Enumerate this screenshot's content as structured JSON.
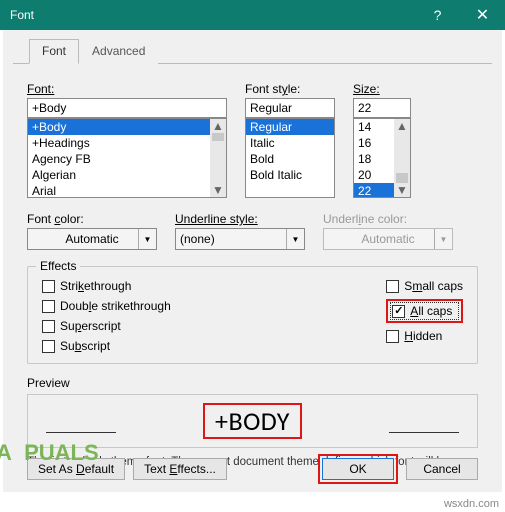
{
  "title": "Font",
  "tabs": {
    "font": "Font",
    "advanced": "Advanced"
  },
  "font": {
    "label": "Font:",
    "value": "+Body",
    "items": [
      "+Body",
      "+Headings",
      "Agency FB",
      "Algerian",
      "Arial"
    ]
  },
  "style": {
    "label": "Font style:",
    "value": "Regular",
    "items": [
      "Regular",
      "Italic",
      "Bold",
      "Bold Italic"
    ]
  },
  "size": {
    "label": "Size:",
    "value": "22",
    "items": [
      "14",
      "16",
      "18",
      "20",
      "22"
    ]
  },
  "fontColor": {
    "label": "Font color:",
    "value": "Automatic"
  },
  "underlineStyle": {
    "label": "Underline style:",
    "value": "(none)"
  },
  "underlineColor": {
    "label": "Underline color:",
    "value": "Automatic"
  },
  "effects": {
    "legend": "Effects",
    "strikethrough": "Strikethrough",
    "doubleStrike": "Double strikethrough",
    "superscript": "Superscript",
    "subscript": "Subscript",
    "smallCaps": "Small caps",
    "allCaps": "All caps",
    "hidden": "Hidden"
  },
  "preview": {
    "label": "Preview",
    "text": "+BODY",
    "desc": "This is the body theme font. The current document theme defines which font will be used."
  },
  "buttons": {
    "setDefault": "Set As Default",
    "textEffects": "Text Effects...",
    "ok": "OK",
    "cancel": "Cancel"
  },
  "watermark": "wsxdn.com",
  "logo": "A  PUALS"
}
